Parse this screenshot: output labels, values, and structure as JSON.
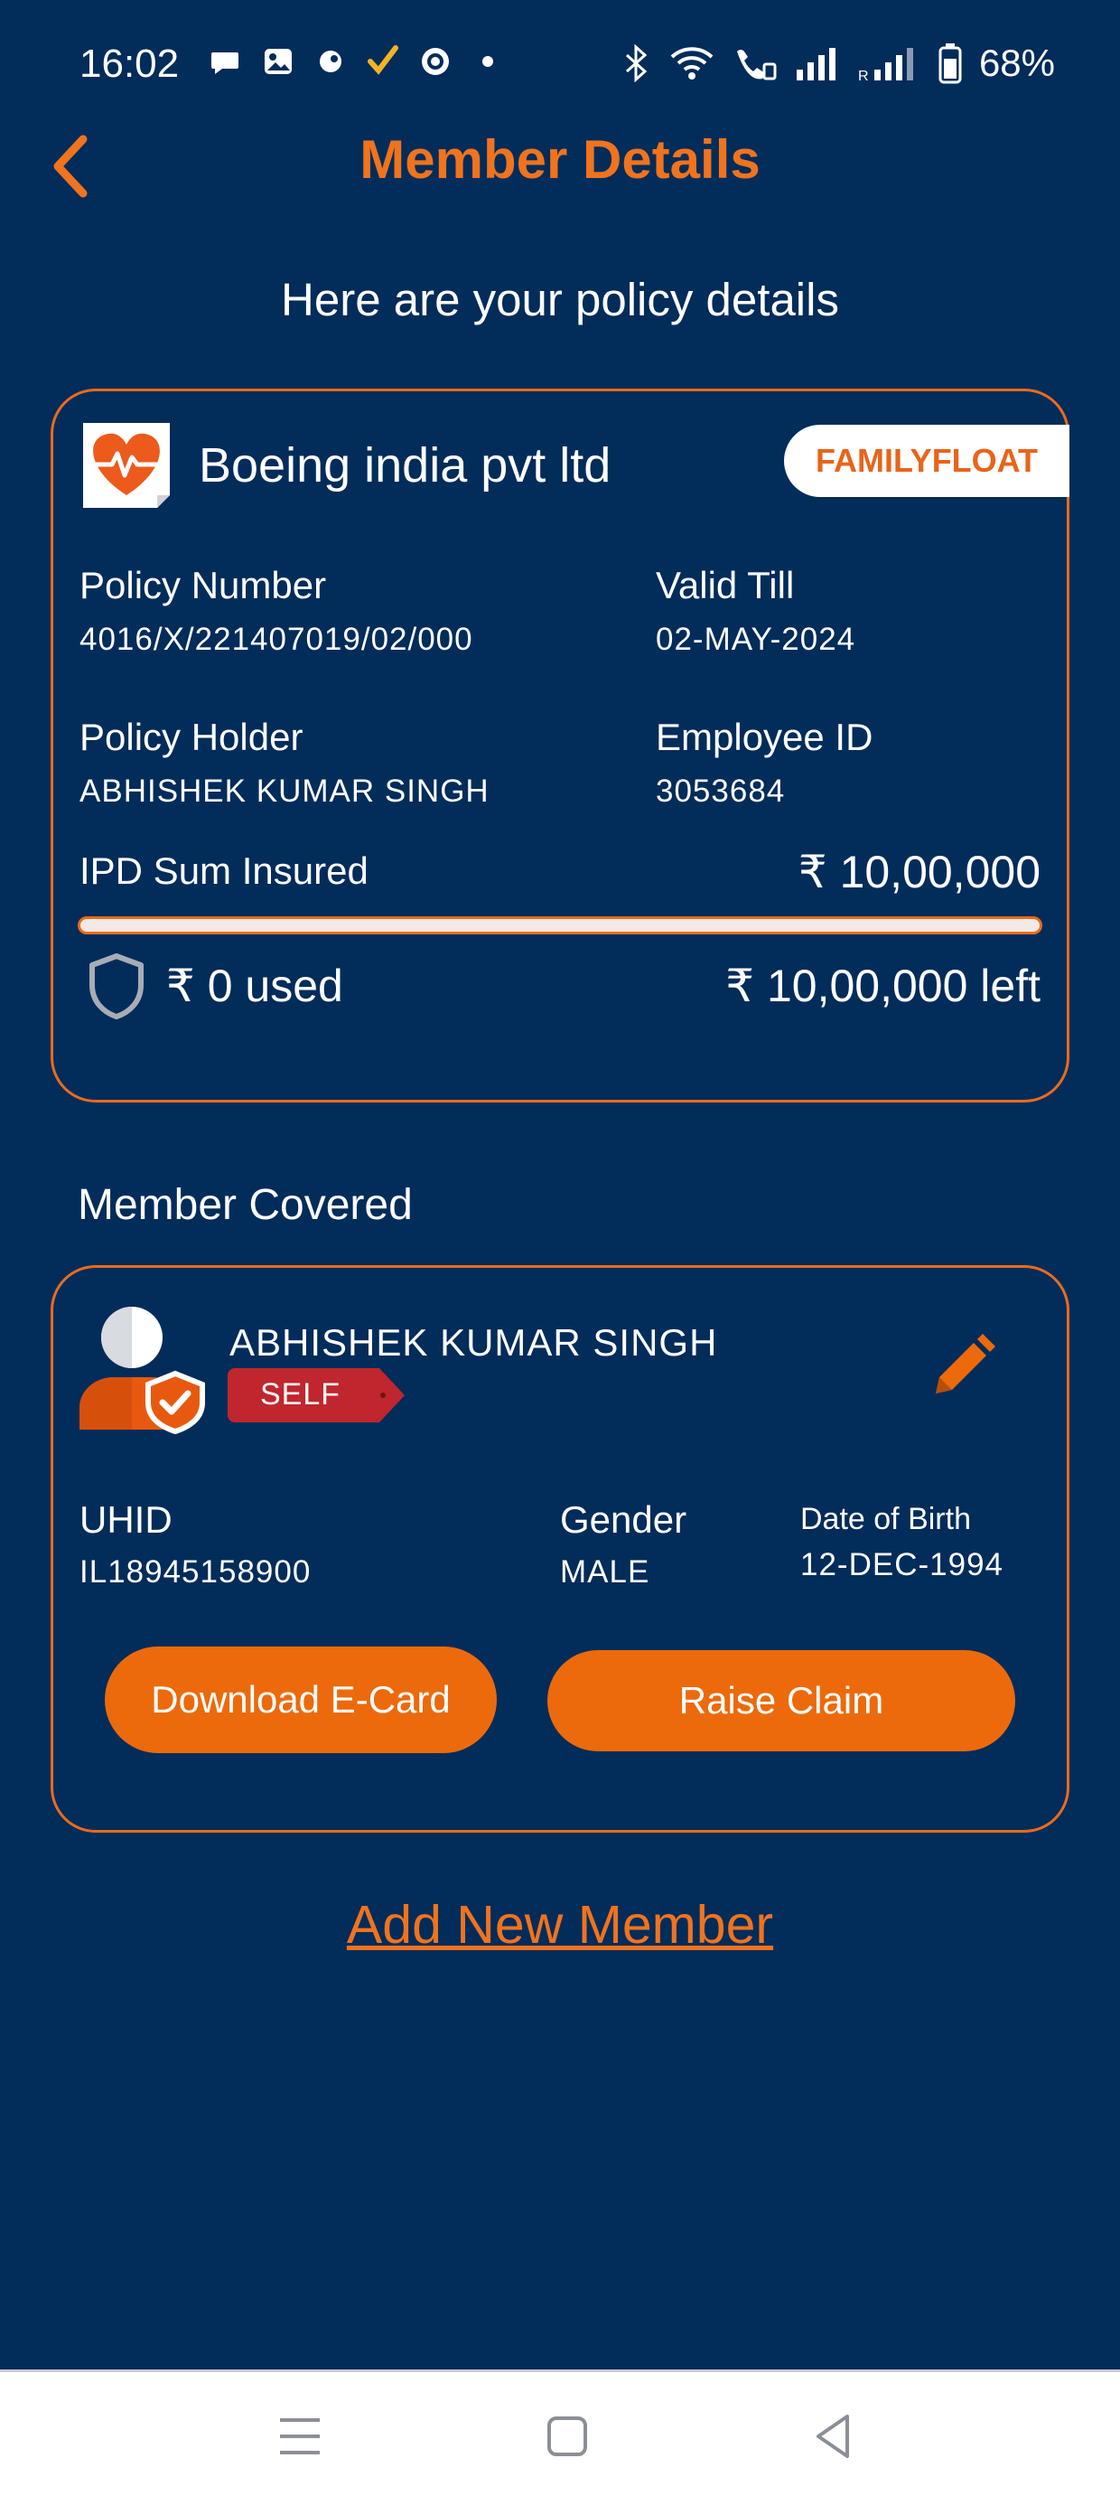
{
  "status_bar": {
    "time": "16:02",
    "battery": "68%",
    "left_icons": [
      "chat-icon",
      "gallery-icon",
      "app-icon",
      "check-icon",
      "record-icon",
      "dot-icon"
    ],
    "right_icons": [
      "bluetooth-icon",
      "wifi-icon",
      "volte-icon",
      "signal-icon",
      "signal-roaming-icon",
      "battery-icon"
    ]
  },
  "header": {
    "title": "Member Details",
    "back_icon": "chevron-left-icon"
  },
  "subtitle": "Here are your policy details",
  "policy": {
    "company": "Boeing india pvt ltd",
    "plan_type": "FAMILYFLOAT",
    "policy_number_label": "Policy Number",
    "policy_number": "4016/X/221407019/02/000",
    "valid_till_label": "Valid Till",
    "valid_till": "02-MAY-2024",
    "holder_label": "Policy Holder",
    "holder": "ABHISHEK KUMAR SINGH",
    "employee_id_label": "Employee ID",
    "employee_id": "3053684",
    "sum_insured_label": "IPD Sum Insured",
    "sum_insured": "₹ 10,00,000",
    "used": "₹ 0 used",
    "left": "₹ 10,00,000 left",
    "used_fraction": 0
  },
  "members": {
    "section_title": "Member Covered",
    "items": [
      {
        "name": "ABHISHEK KUMAR SINGH",
        "relation": "SELF",
        "uhid_label": "UHID",
        "uhid": "IL18945158900",
        "gender_label": "Gender",
        "gender": "MALE",
        "dob_label": "Date of Birth",
        "dob": "12-DEC-1994",
        "download_label": "Download E-Card",
        "claim_label": "Raise Claim"
      }
    ],
    "add_member_label": "Add New Member"
  },
  "colors": {
    "background": "#022c5a",
    "accent": "#ec6a0b",
    "tag_red": "#c0262d"
  },
  "nav": {
    "menu_icon": "menu-icon",
    "home_icon": "home-square-icon",
    "back_icon": "back-triangle-icon"
  }
}
